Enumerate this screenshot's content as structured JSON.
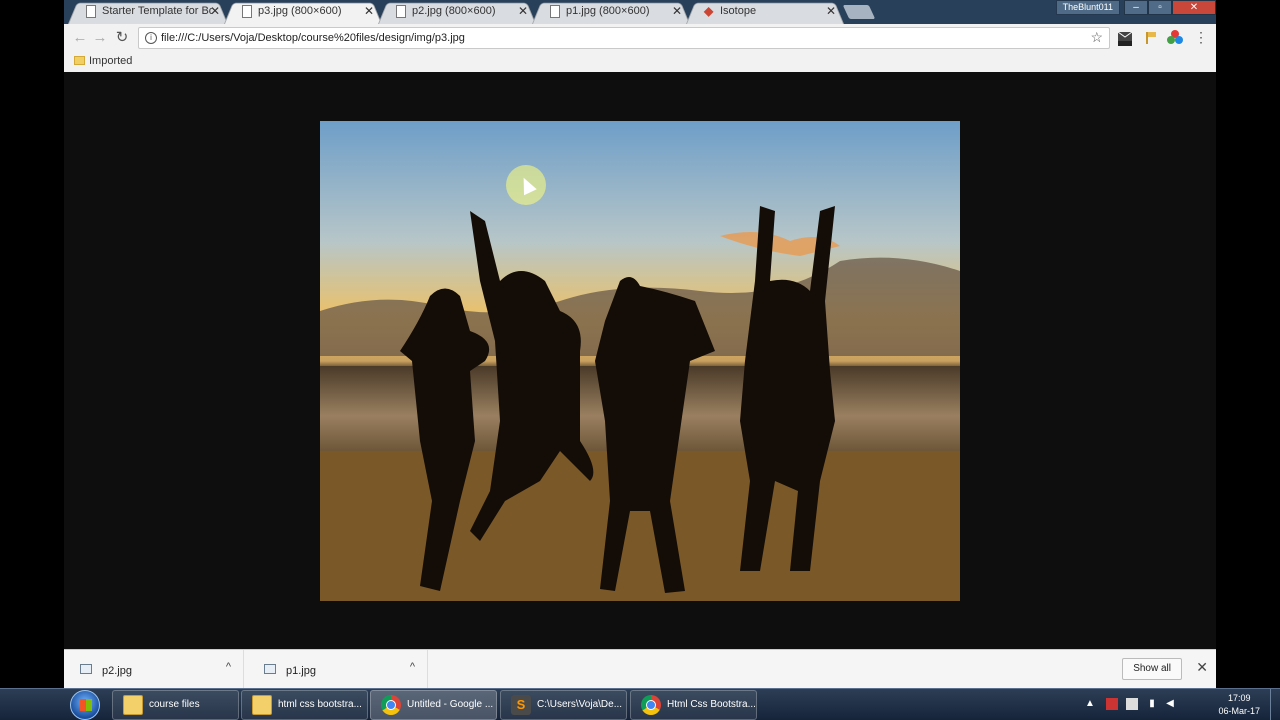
{
  "tabs": [
    {
      "title": "Starter Template for Boo",
      "favicon": "page-icon",
      "active": false
    },
    {
      "title": "p3.jpg (800×600)",
      "favicon": "page-icon",
      "active": true
    },
    {
      "title": "p2.jpg (800×600)",
      "favicon": "page-icon",
      "active": false
    },
    {
      "title": "p1.jpg (800×600)",
      "favicon": "page-icon",
      "active": false
    },
    {
      "title": "Isotope",
      "favicon": "shield-icon",
      "active": false
    }
  ],
  "window": {
    "user": "TheBlunt011",
    "minimize": "–",
    "restore": "▫",
    "close": "✕"
  },
  "toolbar": {
    "back": "←",
    "forward": "→",
    "reload": "↻",
    "url": "file:///C:/Users/Voja/Desktop/course%20files/design/img/p3.jpg",
    "info": "i",
    "star": "☆",
    "menu": "⋮"
  },
  "bookmarks": [
    {
      "label": "Imported"
    }
  ],
  "downloads": {
    "items": [
      {
        "name": "p2.jpg",
        "caret": "^"
      },
      {
        "name": "p1.jpg",
        "caret": "^"
      }
    ],
    "show_all": "Show all",
    "close": "✕"
  },
  "taskbar": {
    "items": [
      {
        "label": "course files",
        "icon": "folder-icon"
      },
      {
        "label": "html css bootstra...",
        "icon": "folder-icon"
      },
      {
        "label": "Untitled - Google ...",
        "icon": "chrome-icon"
      },
      {
        "label": "C:\\Users\\Voja\\De...",
        "icon": "sublime-icon"
      },
      {
        "label": "Html Css Bootstra...",
        "icon": "chrome-icon"
      }
    ],
    "sublime_glyph": "S",
    "clock": {
      "time": "17:09",
      "date": "06-Mar-17"
    }
  },
  "colors": {
    "viewer_bg": "#0e0e0e",
    "tabstrip": "#29405a",
    "sky_top": "#6e9ec8",
    "sunset": "#f0c060",
    "sand": "#8a6a30"
  }
}
